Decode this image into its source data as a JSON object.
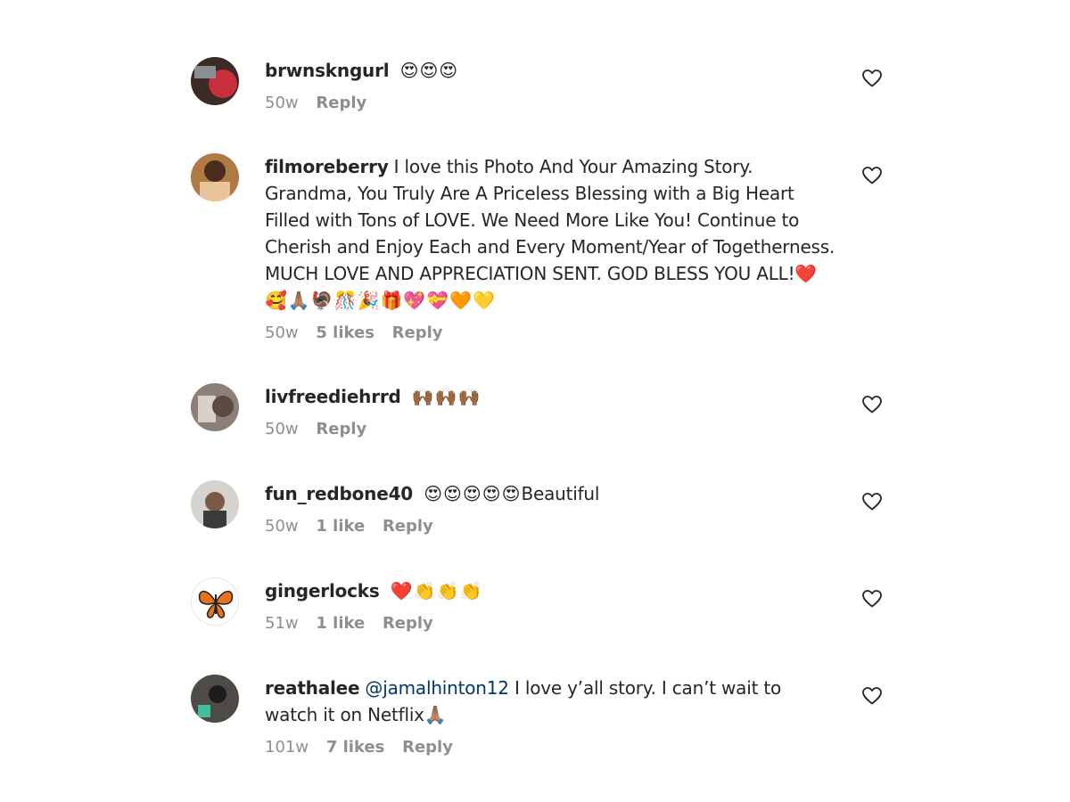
{
  "comments": [
    {
      "username": "brwnskngurl",
      "mention": "",
      "text": "",
      "emojis": "😍😍😍",
      "time": "50w",
      "likes": "",
      "reply": "Reply",
      "avatar": "avatar-photo"
    },
    {
      "username": "filmoreberry",
      "mention": "",
      "text": "I love this Photo And Your Amazing Story. Grandma, You Truly Are A Priceless Blessing with a Big Heart Filled with Tons of LOVE. We Need More Like You! Continue to Cherish and Enjoy Each and Every Moment/Year of Togetherness. MUCH LOVE AND APPRECIATION SENT. GOD BLESS YOU ALL!",
      "emojis": "❤️🥰🙏🏽🦃🎊🎉🎁💖💝🧡💛",
      "time": "50w",
      "likes": "5 likes",
      "reply": "Reply",
      "avatar": "avatar-photo"
    },
    {
      "username": "livfreediehrrd",
      "mention": "",
      "text": "",
      "emojis": "🙌🏾🙌🏾🙌🏾",
      "time": "50w",
      "likes": "",
      "reply": "Reply",
      "avatar": "avatar-photo"
    },
    {
      "username": "fun_redbone40",
      "mention": "",
      "text": "Beautiful",
      "emojis": "😍😍😍😍😍",
      "time": "50w",
      "likes": "1 like",
      "reply": "Reply",
      "avatar": "avatar-photo"
    },
    {
      "username": "gingerlocks",
      "mention": "",
      "text": "",
      "emojis": "❤️👏👏👏",
      "time": "51w",
      "likes": "1 like",
      "reply": "Reply",
      "avatar": "butterfly-avatar"
    },
    {
      "username": "reathalee",
      "mention": "@jamalhinton12",
      "text": "I love y’all story. I can’t wait to watch it on Netflix",
      "emojis": "🙏🏽",
      "time": "101w",
      "likes": "7 likes",
      "reply": "Reply",
      "avatar": "avatar-photo"
    }
  ],
  "icons": {
    "like": "heart-outline-icon"
  },
  "colors": {
    "text": "#262626",
    "meta": "#8e8e8e",
    "mention": "#00376b"
  }
}
